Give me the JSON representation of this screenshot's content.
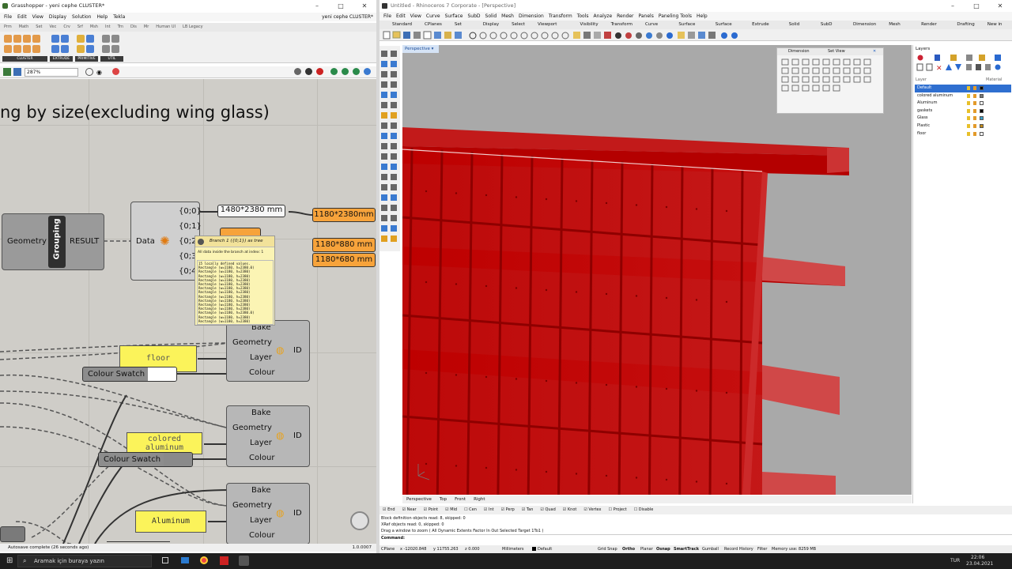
{
  "gh": {
    "title": "Grasshopper - yeni cephe CLUSTER*",
    "menu": [
      "File",
      "Edit",
      "View",
      "Display",
      "Solution",
      "Help",
      "Tekla"
    ],
    "menu_right": "yeni cephe CLUSTER*",
    "tabs": [
      "Prm",
      "Math",
      "Set",
      "Vec",
      "Crv",
      "Srf",
      "Msh",
      "Int",
      "Trn",
      "Dis",
      "Mr",
      "Human UI",
      "LB Legacy"
    ],
    "groups": [
      "CLUSTER",
      "EXTRUDE",
      "PRIMITIVE",
      "UTIL"
    ],
    "zoom": "287%",
    "canvas_title": "ng by size(excluding wing glass)",
    "grouping": {
      "left": "Geometry",
      "cluster": "Grouping",
      "right": "RESULT"
    },
    "data_comp": {
      "input": "Data",
      "outputs": [
        "{0;0}",
        "{0;1}",
        "{0;2",
        "{0;3",
        "{0;4"
      ]
    },
    "panels": [
      "1480*2380 mm",
      "1180*2380mm",
      "1180*880 mm",
      "1180*680 mm"
    ],
    "tooltip": {
      "title": "Branch 1 ({0;1}) as tree",
      "sub": "All data inside the branch at index: 1",
      "lines": [
        "15 locally defined values.",
        "Rectangle (w=1180, h=2380.0)",
        "Rectangle (w=1180, h=2380)",
        "Rectangle (w=1180, h=2380)",
        "Rectangle (w=1180, h=2380)",
        "Rectangle (w=1180, h=2380)",
        "Rectangle (w=1180, h=2380)",
        "Rectangle (w=1180, h=2380)",
        "Rectangle (w=1180, h=2380)",
        "Rectangle (w=1180, h=2380)",
        "Rectangle (w=1180, h=2380)",
        "Rectangle (w=1180, h=2380)",
        "Rectangle (w=1180, h=2380.0)",
        "Rectangle (w=1180, h=2380)",
        "Rectangle (w=1180, h=2380)"
      ]
    },
    "bake": {
      "inputs": [
        "Bake",
        "Geometry",
        "Layer",
        "Colour"
      ],
      "output": "ID"
    },
    "layer_names": [
      "floor",
      "colored aluminum",
      "Aluminum"
    ],
    "swatch_label": "Colour Swatch",
    "swatch_colors": [
      "#ffffff",
      "#8a8a8a"
    ],
    "status": "Autosave complete (26 seconds ago)",
    "version": "1.0.0007"
  },
  "rhino": {
    "title": "Untitled - Rhinoceros 7 Corporate - [Perspective]",
    "menu": [
      "File",
      "Edit",
      "View",
      "Curve",
      "Surface",
      "SubD",
      "Solid",
      "Mesh",
      "Dimension",
      "Transform",
      "Tools",
      "Analyze",
      "Render",
      "Panels",
      "Paneling Tools",
      "Help"
    ],
    "tabs": [
      "Standard",
      "CPlanes",
      "Set View",
      "Display",
      "Select",
      "Viewport Layout",
      "Visibility",
      "Transform",
      "Curve Tools",
      "Surface Tools",
      "Surface Tools",
      "Extrude Solid",
      "Solid Tools",
      "SubD Tools",
      "Dimension",
      "Mesh Tools",
      "Render Tools",
      "Drafting",
      "New in V7"
    ],
    "viewport": "Perspective",
    "dim_tabs": [
      "Dimension",
      "Set View"
    ],
    "layers_title": "Layers",
    "layer_header": {
      "name": "Layer",
      "material": "Material"
    },
    "layers": [
      {
        "name": "Default",
        "color": "#000000",
        "selected": true
      },
      {
        "name": "colored aluminum",
        "color": "#777777"
      },
      {
        "name": "Aluminum",
        "color": "#ffffff"
      },
      {
        "name": "gaskets",
        "color": "#000000"
      },
      {
        "name": "Glass",
        "color": "#3aa0c8"
      },
      {
        "name": "Plastic",
        "color": "#c08a1a"
      },
      {
        "name": "floor",
        "color": "#ffffff"
      }
    ],
    "vp_tabs": [
      "Perspective",
      "Top",
      "Front",
      "Right"
    ],
    "snaps": [
      "End",
      "Near",
      "Point",
      "Mid",
      "Cen",
      "Int",
      "Perp",
      "Tan",
      "Quad",
      "Knot",
      "Vertex",
      "Project",
      "Disable"
    ],
    "cmd_lines": [
      "Block definition objects read: 8, skipped: 0",
      "XRef objects read: 0, skipped: 0",
      "Drag a window to zoom ( All  Dynamic  Extents  Factor  In  Out  Selected  Target  1To1 )"
    ],
    "cmd_prompt": "Command:",
    "status": {
      "cplane": "CPlane",
      "x": "x -12020.848",
      "y": "y 11755.263",
      "z": "z 0.000",
      "units": "Millimeters",
      "layer": "Default",
      "toggles": [
        "Grid Snap",
        "Ortho",
        "Planar",
        "Osnap",
        "SmartTrack",
        "Gumball",
        "Record History",
        "Filter"
      ],
      "memory": "Memory use: 8259 MB"
    },
    "mesh_color": "#c40000"
  },
  "taskbar": {
    "search": "Aramak için buraya yazın",
    "lang": "TUR",
    "time": "22:06",
    "date": "23.04.2021"
  }
}
